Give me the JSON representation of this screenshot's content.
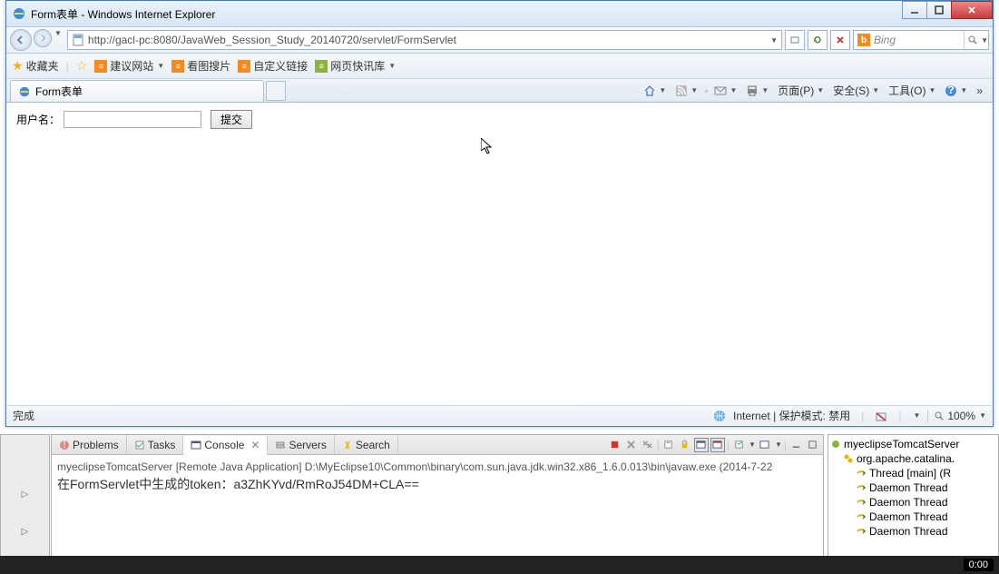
{
  "window": {
    "title": "Form表单 - Windows Internet Explorer"
  },
  "address": {
    "url": "http://gacl-pc:8080/JavaWeb_Session_Study_20140720/servlet/FormServlet"
  },
  "search": {
    "engine": "Bing"
  },
  "favbar": {
    "favorites": "收藏夹",
    "suggest": "建议网站",
    "imgsearch": "看图搜片",
    "customlink": "自定义链接",
    "webslice": "网页快讯库"
  },
  "tab": {
    "title": "Form表单"
  },
  "cmd": {
    "page": "页面(P)",
    "security": "安全(S)",
    "tools": "工具(O)"
  },
  "form": {
    "label": "用户名：",
    "submit": "提交"
  },
  "status": {
    "done": "完成",
    "zone": "Internet | 保护模式: 禁用",
    "zoom": "100%"
  },
  "eclipse": {
    "tabs": {
      "problems": "Problems",
      "tasks": "Tasks",
      "console": "Console",
      "servers": "Servers",
      "search": "Search"
    },
    "line1": "myeclipseTomcatServer [Remote Java Application] D:\\MyEclipse10\\Common\\binary\\com.sun.java.jdk.win32.x86_1.6.0.013\\bin\\javaw.exe (2014-7-22",
    "line2": "在FormServlet中生成的token：a3ZhKYvd/RmRoJ54DM+CLA=="
  },
  "debug": {
    "root": "myeclipseTomcatServer",
    "node": "org.apache.catalina.",
    "t1": "Thread [main] (R",
    "t2": "Daemon Thread",
    "t3": "Daemon Thread",
    "t4": "Daemon Thread",
    "t5": "Daemon Thread"
  },
  "clock": "0:00"
}
